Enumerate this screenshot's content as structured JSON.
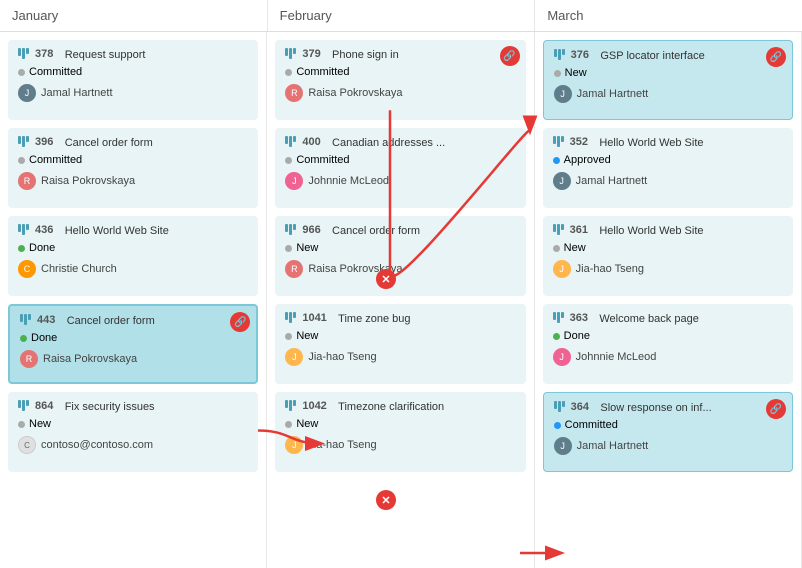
{
  "columns": [
    {
      "label": "January",
      "cards": [
        {
          "id": "378",
          "name": "Request support",
          "status": "Committed",
          "statusType": "committed",
          "assignee": "Jamal Hartnett",
          "avatarClass": "jamal",
          "avatarInitial": "J",
          "highlighted": false,
          "hasLink": false
        },
        {
          "id": "396",
          "name": "Cancel order form",
          "status": "Committed",
          "statusType": "committed",
          "assignee": "Raisa Pokrovskaya",
          "avatarClass": "raisa",
          "avatarInitial": "R",
          "highlighted": false,
          "hasLink": false
        },
        {
          "id": "436",
          "name": "Hello World Web Site",
          "status": "Done",
          "statusType": "done",
          "assignee": "Christie Church",
          "avatarClass": "christie",
          "avatarInitial": "C",
          "highlighted": false,
          "hasLink": false
        },
        {
          "id": "443",
          "name": "Cancel order form",
          "status": "Done",
          "statusType": "done",
          "assignee": "Raisa Pokrovskaya",
          "avatarClass": "raisa",
          "avatarInitial": "R",
          "highlighted": true,
          "hasLink": true
        },
        {
          "id": "864",
          "name": "Fix security issues",
          "status": "New",
          "statusType": "new",
          "assignee": "contoso@contoso.com",
          "avatarClass": "contoso",
          "avatarInitial": "C",
          "highlighted": false,
          "hasLink": false
        }
      ]
    },
    {
      "label": "February",
      "cards": [
        {
          "id": "379",
          "name": "Phone sign in",
          "status": "Committed",
          "statusType": "committed",
          "assignee": "Raisa Pokrovskaya",
          "avatarClass": "raisa",
          "avatarInitial": "R",
          "highlighted": false,
          "hasLink": true
        },
        {
          "id": "400",
          "name": "Canadian addresses ...",
          "status": "Committed",
          "statusType": "committed",
          "assignee": "Johnnie McLeod",
          "avatarClass": "johnnie",
          "avatarInitial": "J",
          "highlighted": false,
          "hasLink": false
        },
        {
          "id": "966",
          "name": "Cancel order form",
          "status": "New",
          "statusType": "new",
          "assignee": "Raisa Pokrovskaya",
          "avatarClass": "raisa",
          "avatarInitial": "R",
          "highlighted": false,
          "hasLink": false
        },
        {
          "id": "1041",
          "name": "Time zone bug",
          "status": "New",
          "statusType": "new",
          "assignee": "Jia-hao Tseng",
          "avatarClass": "jia",
          "avatarInitial": "J",
          "highlighted": false,
          "hasLink": false
        },
        {
          "id": "1042",
          "name": "Timezone clarification",
          "status": "New",
          "statusType": "new",
          "assignee": "Jia-hao Tseng",
          "avatarClass": "jia",
          "avatarInitial": "J",
          "highlighted": false,
          "hasLink": false
        }
      ]
    },
    {
      "label": "March",
      "cards": [
        {
          "id": "376",
          "name": "GSP locator interface",
          "status": "New",
          "statusType": "new",
          "assignee": "Jamal Hartnett",
          "avatarClass": "jamal",
          "avatarInitial": "J",
          "highlighted": true,
          "hasLink": true
        },
        {
          "id": "352",
          "name": "Hello World Web Site",
          "status": "Approved",
          "statusType": "approved",
          "assignee": "Jamal Hartnett",
          "avatarClass": "jamal",
          "avatarInitial": "J",
          "highlighted": false,
          "hasLink": false
        },
        {
          "id": "361",
          "name": "Hello World Web Site",
          "status": "New",
          "statusType": "new",
          "assignee": "Jia-hao Tseng",
          "avatarClass": "jia",
          "avatarInitial": "J",
          "highlighted": false,
          "hasLink": false
        },
        {
          "id": "363",
          "name": "Welcome back page",
          "status": "Done",
          "statusType": "done",
          "assignee": "Johnnie McLeod",
          "avatarClass": "johnnie",
          "avatarInitial": "J",
          "highlighted": false,
          "hasLink": false
        },
        {
          "id": "364",
          "name": "Slow response on inf...",
          "status": "Committed",
          "statusType": "committed",
          "assignee": "Jamal Hartnett",
          "avatarClass": "jamal",
          "avatarInitial": "J",
          "highlighted": true,
          "hasLink": true
        }
      ]
    }
  ]
}
